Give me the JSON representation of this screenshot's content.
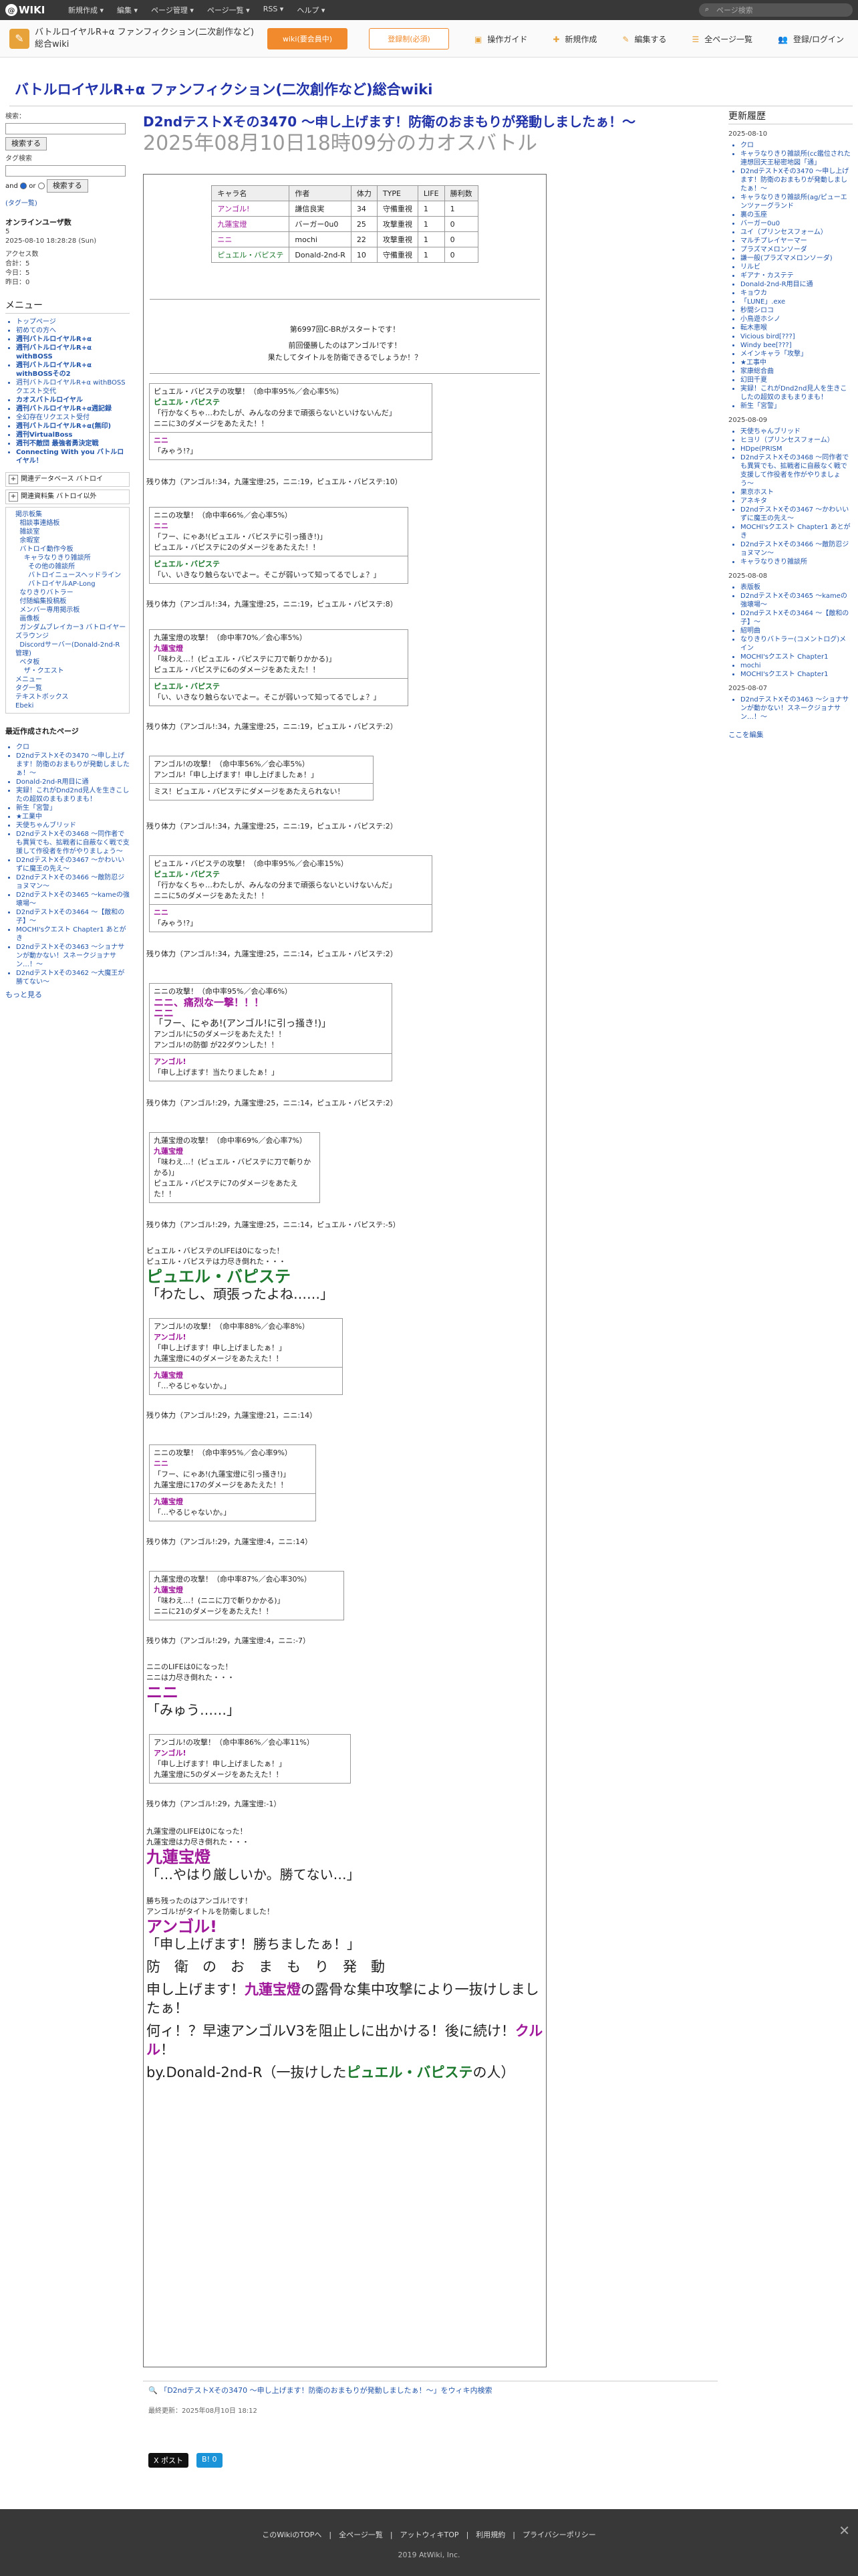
{
  "topbar": {
    "logo": "WIKI",
    "menus": [
      "新規作成 ▾",
      "編集 ▾",
      "ページ管理 ▾",
      "ページ一覧 ▾",
      "RSS ▾",
      "ヘルプ ▾"
    ],
    "search_placeholder": "ページ検索"
  },
  "subbar": {
    "site_name": "バトルロイヤルR+α ファンフィクション(二次創作など)総合wiki",
    "btn_wiki": "wiki(要会員中)",
    "btn_member": "登録制(必須)",
    "tools": [
      "操作ガイド",
      "新規作成",
      "編集する",
      "全ページ一覧",
      "登録/ログイン"
    ]
  },
  "site_title": "バトルロイヤルR+α ファンフィクション(二次創作など)総合wiki",
  "left": {
    "search_label": "検索：",
    "search_btn": "検索する",
    "tag_label": "タグ検索",
    "and": "and",
    "or": "or",
    "tag_search_btn": "検索する",
    "tag_list": "(タグ一覧)",
    "online_title": "オンラインユーザ数",
    "online_count": "5",
    "online_date": "2025-08-10 18:28:28 (Sun)",
    "access_title": "アクセス数",
    "access_lines": [
      "合計：5",
      "今日：5",
      "昨日：0"
    ],
    "menu_title": "メニュー",
    "menu_items": [
      {
        "t": "トップページ",
        "b": false
      },
      {
        "t": "初めての方へ",
        "b": false
      },
      {
        "t": "週刊バトルロイヤルR+α",
        "b": true
      },
      {
        "t": "週刊バトルロイヤルR+α withBOSS",
        "b": true
      },
      {
        "t": "週刊バトルロイヤルR+α withBOSSその2",
        "b": true
      },
      {
        "t": "週刊バトルロイヤルR+α withBOSSクエスト交代",
        "b": false
      },
      {
        "t": "カオスバトルロイヤル",
        "b": true
      },
      {
        "t": "週刊バトルロイヤルR+α週記録",
        "b": true
      },
      {
        "t": "全幻存在リクエスト受付",
        "b": false
      },
      {
        "t": "週刊バトルロイヤルR+α(無印)",
        "b": true
      },
      {
        "t": "週刊VirtualBoss",
        "b": true
      },
      {
        "t": "週刊不敵団 最強者勇決定戦",
        "b": true
      },
      {
        "t": "Connecting With you バトルロイヤル！",
        "b": true
      }
    ],
    "related_title": "関連データベース バトロイ",
    "related2_title": "関連資料集 バトロイ以外",
    "tree_items": [
      "掲示板集",
      "  相談事連絡板",
      "  雑談室",
      "  余暇室",
      "  バトロイ動作今板",
      "    キャラなりきり雑談所",
      "      その他の雑談所",
      "      バトロイニュースヘッドライン",
      "      バトロイヤルAP-Long",
      "  なりきりバトラー",
      "  付随編集投稿板",
      "  メンバー専用掲示板",
      "  画像板",
      "  ガンダムブレイカー3 バトロイヤーズラウンジ",
      "  Discordサーバー(Donald-2nd-R管理)",
      "  ベタ板",
      "    ザ・クエスト",
      "メニュー",
      "タグ一覧",
      "テキストボックス",
      "Ebeki"
    ],
    "recent_title": "最近作成されたページ",
    "recent_items": [
      "クロ",
      "D2ndテストXその3470 〜申し上げます！防衛のおまもりが発動しましたぁ！〜",
      "Donald-2nd-R用目に通",
      "実録！これがDnd2nd見人を生きこしたの超奴のまもまりまも！",
      "新生「宮警」",
      "★工業中",
      "天使ちゃんブリッド",
      "D2ndテストXその3468 〜同作者でも異質でも、拡戦者に自蔽なく戦で支援して作役者を作がやりましょう〜",
      "D2ndテストXその3467 〜かわいいずに魔王の先え〜",
      "D2ndテストXその3466 〜敵防忍ジョヌマン〜",
      "D2ndテストXその3465 〜kameの強壊場〜",
      "D2ndテストXその3464 〜【敵和の子】〜",
      "MOCHI'sクエスト Chapter1 あとがき",
      "D2ndテストXその3463 〜ショナサンが動かない！スネークジョナサン…！〜",
      "D2ndテストXその3462 〜大魔王が勝てない〜"
    ],
    "more": "もっと見る"
  },
  "page": {
    "title": "D2ndテストXその3470 〜申し上げます！防衛のおまもりが発動しましたぁ！〜",
    "subtitle": "2025年08月10日18時09分のカオスバトル"
  },
  "chars_table": {
    "headers": [
      "キャラ名",
      "作者",
      "体力",
      "TYPE",
      "LIFE",
      "勝利数"
    ],
    "rows": [
      [
        "アンゴル!",
        "謙信良実",
        "34",
        "守備重視",
        "1",
        "1"
      ],
      [
        "九蓮宝燈",
        "バーガー0u0",
        "25",
        "攻撃重視",
        "1",
        "0"
      ],
      [
        "ニニ",
        "mochi",
        "22",
        "攻撃重視",
        "1",
        "0"
      ],
      [
        "ピュエル・バピステ",
        "Donald-2nd-R",
        "10",
        "守備重視",
        "1",
        "0"
      ]
    ]
  },
  "intro": {
    "l1": "第6997回C-BRがスタートです！",
    "l2": "前回優勝したのはアンゴル!です！",
    "l3": "果たしてタイトルを防衛できるでしょうか！？"
  },
  "rounds": [
    {
      "hp": "残り体力（アンゴル!:34，九蓮宝燈:25，ニニ:19，ピュエル・バピステ:10）"
    },
    {
      "hp": "残り体力（アンゴル!:34，九蓮宝燈:25，ニニ:19，ピュエル・バピステ:8）"
    },
    {
      "hp": "残り体力（アンゴル!:34，九蓮宝燈:25，ニニ:19，ピュエル・バピステ:2）"
    },
    {
      "hp": "残り体力（アンゴル!:34，九蓮宝燈:25，ニニ:19，ピュエル・バピステ:2）"
    },
    {
      "hp": "残り体力（アンゴル!:34，九蓮宝燈:25，ニニ:14，ピュエル・バピステ:2）"
    },
    {
      "hp": "残り体力（アンゴル!:29，九蓮宝燈:25，ニニ:14，ピュエル・バピステ:2）"
    },
    {
      "hp": "残り体力（アンゴル!:29，九蓮宝燈:25，ニニ:14，ピュエル・バピステ:-5）"
    },
    {
      "hp": "残り体力（アンゴル!:29，九蓮宝燈:21，ニニ:14）"
    },
    {
      "hp": "残り体力（アンゴル!:29，九蓮宝燈:4，ニニ:14）"
    },
    {
      "hp": "残り体力（アンゴル!:29，九蓮宝燈:4，ニニ:-7）"
    },
    {
      "hp": "残り体力（アンゴル!:29，九蓮宝燈:-1）"
    }
  ],
  "battle": {
    "b1a": "ピュエル・バピステの攻撃！（命中率95%／会心率5%）",
    "b1b": "ピュエル・バピステ",
    "b1c": "「行かなくちゃ…わたしが、みんなの分まで頑張らないといけないんだ」",
    "b1d": "ニニに3のダメージをあたえた！！",
    "b1e": "ニニ",
    "b1f": "「みゃう!?」",
    "b2a": "ニニの攻撃！（命中率66%／会心率5%）",
    "b2b": "ニニ",
    "b2c": "「フー、にゃあ!(ピュエル・バピステに引っ掻き!)」",
    "b2d": "ピュエル・バピステに2のダメージをあたえた！！",
    "b2e": "ピュエル・バピステ",
    "b2f": "「い、いきなり触らないでよー。そこが弱いって知ってるでしょ？」",
    "b3a": "九蓮宝燈の攻撃！（命中率70%／会心率5%）",
    "b3b": "九蓮宝燈",
    "b3c": "「味わえ…！(ピュエル・バピステに刀で斬りかかる)」",
    "b3d": "ピュエル・バピステに6のダメージをあたえた！！",
    "b3e": "ピュエル・バピステ",
    "b3f": "「い、いきなり触らないでよー。そこが弱いって知ってるでしょ？」",
    "b4a": "アンゴル!の攻撃！（命中率56%／会心率5%）",
    "b4b": "アンゴル!「申し上げます！申し上げましたぁ！」",
    "b4c": "ミス！ピュエル・バピステにダメージをあたえられない！",
    "b5a": "ピュエル・バピステの攻撃！（命中率95%／会心率15%）",
    "b5b": "ピュエル・バピステ",
    "b5c": "「行かなくちゃ…わたしが、みんなの分まで頑張らないといけないんだ」",
    "b5d": "ニニに5のダメージをあたえた！！",
    "b5e": "ニニ",
    "b5f": "「みゃう!?」",
    "b6a": "ニニの攻撃！（命中率95%／会心率6%）",
    "b6b": "ニニ、痛烈な一撃！！！",
    "b6c": "ニニ",
    "b6d": "「フー、にゃあ!(アンゴル!に引っ掻き!)」",
    "b6e": "アンゴル!に5のダメージをあたえた！！",
    "b6f": "アンゴル!の防御 が22ダウンした！！",
    "b6g": "アンゴル!",
    "b6h": "「申し上げます！当たりましたぁ！」",
    "b7a": "九蓮宝燈の攻撃！（命中率69%／会心率7%）",
    "b7b": "九蓮宝燈",
    "b7c": "「味わえ…！(ピュエル・バピステに刀で斬りかかる)」",
    "b7d": "ピュエル・バピステに7のダメージをあたえた！！",
    "d1": "ピュエル・バピステのLIFEは0になった！",
    "d2": "ピュエル・バピステは力尽き倒れた・・・",
    "d3": "ピュエル・バピステ",
    "d4": "「わたし、頑張ったよね……」",
    "b8a": "アンゴル!の攻撃！（命中率88%／会心率8%）",
    "b8b": "アンゴル!",
    "b8c": "「申し上げます！申し上げましたぁ！」",
    "b8d": "九蓮宝燈に4のダメージをあたえた！！",
    "b8e": "九蓮宝燈",
    "b8f": "「…やるじゃないか。」",
    "b9a": "ニニの攻撃！（命中率95%／会心率9%）",
    "b9b": "ニニ",
    "b9c": "「フー、にゃあ!(九蓮宝燈に引っ掻き!)」",
    "b9d": "九蓮宝燈に17のダメージをあたえた！！",
    "b9e": "九蓮宝燈",
    "b9f": "「…やるじゃないか。」",
    "b10a": "九蓮宝燈の攻撃！（命中率87%／会心率30%）",
    "b10b": "九蓮宝燈",
    "b10c": "「味わえ…！(ニニに刀で斬りかかる)」",
    "b10d": "ニニに21のダメージをあたえた！！",
    "d5": "ニニのLIFEは0になった！",
    "d6": "ニニは力尽き倒れた・・・",
    "d7": "ニニ",
    "d8": "「みゅう……」",
    "b11a": "アンゴル!の攻撃！（命中率86%／会心率11%）",
    "b11b": "アンゴル!",
    "b11c": "「申し上げます！申し上げましたぁ！」",
    "b11d": "九蓮宝燈に5のダメージをあたえた！！",
    "d9": "九蓮宝燈のLIFEは0になった！",
    "d10": "九蓮宝燈は力尽き倒れた・・・",
    "d11": "九蓮宝燈",
    "d12": "「…やはり厳しいか。勝てない…」"
  },
  "ending": {
    "e1": "勝ち残ったのはアンゴル!です！",
    "e2": "アンゴル!がタイトルを防衛しました！",
    "e3": "アンゴル!",
    "e4": "「申し上げます！勝ちましたぁ！」",
    "e5": "防　衛　の　お　ま　も　り　発　動",
    "e6a": "申し上げます！",
    "e6b": "九蓮宝燈",
    "e6c": "の露骨な集中攻撃により一抜けしましたぁ！",
    "e7a": "何ィ！？早速アンゴルV3を阻止しに出かける！後に続け！",
    "e7b": "クルル",
    "e7c": "！",
    "e8a": "by.Donald-2nd-R（一抜けした",
    "e8b": "ピュエル・バピステ",
    "e8c": "の人）"
  },
  "footer_area": {
    "share": "「D2ndテストXその3470 〜申し上げます！防衛のおまもりが発動しましたぁ！〜」をウィキ内検索",
    "lastmod": "最終更新：2025年08月10日 18:12",
    "post_btn": "X ポスト",
    "share_btn": "B! 0",
    "links": "このWikiのTOPへ　|　全ページ一覧　|　アットウィキTOP　|　利用規約　|　プライバシーポリシー",
    "copy": "2019 AtWiki, Inc."
  },
  "right": {
    "title": "更新履歴",
    "groups": [
      {
        "date": "2025-08-10",
        "items": [
          "クロ",
          "キャラなりきり雑談所(cc鑑位された連想回天王秘密地図「通」",
          "D2ndテストXその3470 〜申し上げます！防衛のおまもりが発動しましたぁ！〜",
          "キャラなりきり雑談所(ag/ピューエンツァーグランド",
          "裏の玉座",
          "バーガー0u0",
          "ユイ（プリンセスフォーム）",
          "マルチプレイヤーマー",
          "プラズマメロンソーダ",
          "謙一般(プラズマメロンソーダ)",
          "リルビ",
          "ギアナ・カステテ",
          "Donald-2nd-R用目に通",
          "キョウカ",
          "「LUNE」.exe",
          "秒間シロコ",
          "小鳥遊ホシノ",
          "転木恵喉",
          "Vicious bird[???]",
          "Windy bee[???]",
          "メインキャラ「攻撃」",
          "★工事中",
          "家康総合曲",
          "幻田千夏",
          "実録！これがDnd2nd見人を生きこしたの超奴のまもまりまも！",
          "新生「宮警」"
        ]
      },
      {
        "date": "2025-08-09",
        "items": [
          "天使ちゃんブリッド",
          "ヒヨリ（プリンセスフォーム）",
          "HDpe(PRISM",
          "D2ndテストXその3468 〜同作者でも異質でも、拡戦者に自蔽なく戦で支援して作役者を作がやりましょう〜",
          "果京ホスト",
          "アネキタ",
          "D2ndテストXその3467 〜かわいいずに魔王の先え〜",
          "MOCHI'sクエスト Chapter1 あとがき",
          "D2ndテストXその3466 〜敵防忍ジョヌマン〜",
          "キャラなりきり雑談所"
        ]
      },
      {
        "date": "2025-08-08",
        "items": [
          "表版板",
          "D2ndテストXその3465 〜kameの強壊場〜",
          "D2ndテストXその3464 〜【敵和の子】〜",
          "紹明曲",
          "なりきりバトラー(コメントログ)メイン",
          "MOCHI'sクエスト Chapter1",
          "mochi",
          "MOCHI'sクエスト Chapter1"
        ]
      },
      {
        "date": "2025-08-07",
        "items": [
          "D2ndテストXその3463 〜ショナサンが動かない！スネークジョナサン…！〜"
        ]
      }
    ],
    "more": "ここを編集"
  }
}
